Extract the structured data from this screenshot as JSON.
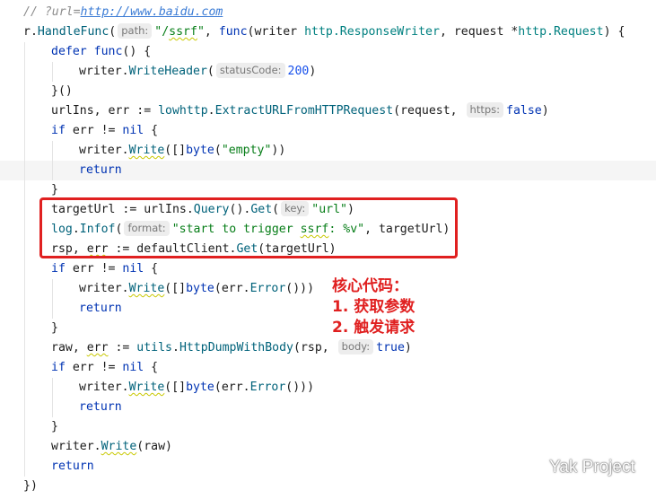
{
  "code": {
    "lines": [
      {
        "indent": 0,
        "tokens": [
          {
            "t": "// ?url=",
            "c": "cm"
          },
          {
            "t": "http://www.baidu.com",
            "c": "cm url"
          }
        ]
      },
      {
        "indent": 0,
        "tokens": [
          {
            "t": "r.",
            "c": ""
          },
          {
            "t": "HandleFunc",
            "c": "fn"
          },
          {
            "t": "(",
            "c": ""
          },
          {
            "hint": "path:"
          },
          {
            "t": "\"/",
            "c": "str"
          },
          {
            "t": "ssrf",
            "c": "str wavy"
          },
          {
            "t": "\"",
            "c": "str"
          },
          {
            "t": ", ",
            "c": ""
          },
          {
            "t": "func",
            "c": "kw"
          },
          {
            "t": "(writer ",
            "c": ""
          },
          {
            "t": "http.ResponseWriter",
            "c": "typ"
          },
          {
            "t": ", request *",
            "c": ""
          },
          {
            "t": "http.Request",
            "c": "typ"
          },
          {
            "t": ") {",
            "c": ""
          }
        ]
      },
      {
        "indent": 1,
        "tokens": [
          {
            "t": "defer ",
            "c": "kw"
          },
          {
            "t": "func",
            "c": "kw"
          },
          {
            "t": "() {",
            "c": ""
          }
        ]
      },
      {
        "indent": 2,
        "tokens": [
          {
            "t": "writer.",
            "c": ""
          },
          {
            "t": "WriteHeader",
            "c": "fn"
          },
          {
            "t": "(",
            "c": ""
          },
          {
            "hint": "statusCode:"
          },
          {
            "t": "200",
            "c": "num"
          },
          {
            "t": ")",
            "c": ""
          }
        ]
      },
      {
        "indent": 1,
        "tokens": [
          {
            "t": "}()",
            "c": ""
          }
        ]
      },
      {
        "indent": 1,
        "tokens": [
          {
            "t": "urlIns, err := ",
            "c": ""
          },
          {
            "t": "lowhttp",
            "c": "fn"
          },
          {
            "t": ".",
            "c": ""
          },
          {
            "t": "ExtractURLFromHTTPRequest",
            "c": "fn"
          },
          {
            "t": "(request, ",
            "c": ""
          },
          {
            "hint": "https:"
          },
          {
            "t": "false",
            "c": "kw"
          },
          {
            "t": ")",
            "c": ""
          }
        ]
      },
      {
        "indent": 1,
        "tokens": [
          {
            "t": "if ",
            "c": "kw"
          },
          {
            "t": "err != ",
            "c": ""
          },
          {
            "t": "nil",
            "c": "kw"
          },
          {
            "t": " {",
            "c": ""
          }
        ]
      },
      {
        "indent": 2,
        "tokens": [
          {
            "t": "writer.",
            "c": ""
          },
          {
            "t": "Write",
            "c": "fn wavy"
          },
          {
            "t": "([]",
            "c": ""
          },
          {
            "t": "byte",
            "c": "kw"
          },
          {
            "t": "(",
            "c": ""
          },
          {
            "t": "\"empty\"",
            "c": "str"
          },
          {
            "t": "))",
            "c": ""
          }
        ]
      },
      {
        "indent": 2,
        "hl": true,
        "tokens": [
          {
            "t": "return",
            "c": "kw"
          }
        ]
      },
      {
        "indent": 1,
        "tokens": [
          {
            "t": "}",
            "c": ""
          }
        ]
      },
      {
        "indent": 1,
        "tokens": [
          {
            "t": "targetUrl := urlIns.",
            "c": ""
          },
          {
            "t": "Query",
            "c": "fn"
          },
          {
            "t": "().",
            "c": ""
          },
          {
            "t": "Get",
            "c": "fn"
          },
          {
            "t": "(",
            "c": ""
          },
          {
            "hint": "key:"
          },
          {
            "t": "\"url\"",
            "c": "str"
          },
          {
            "t": ")",
            "c": ""
          }
        ]
      },
      {
        "indent": 1,
        "tokens": [
          {
            "t": "log",
            "c": "fn"
          },
          {
            "t": ".",
            "c": ""
          },
          {
            "t": "Infof",
            "c": "fn"
          },
          {
            "t": "(",
            "c": ""
          },
          {
            "hint": "format:"
          },
          {
            "t": "\"start to trigger ",
            "c": "str"
          },
          {
            "t": "ssrf",
            "c": "str wavy"
          },
          {
            "t": ": %v\"",
            "c": "str"
          },
          {
            "t": ", targetUrl)",
            "c": ""
          }
        ]
      },
      {
        "indent": 1,
        "tokens": [
          {
            "t": "rsp, ",
            "c": ""
          },
          {
            "t": "err",
            "c": "wavy"
          },
          {
            "t": " := defaultClient.",
            "c": ""
          },
          {
            "t": "Get",
            "c": "fn"
          },
          {
            "t": "(targetUrl)",
            "c": ""
          }
        ]
      },
      {
        "indent": 1,
        "tokens": [
          {
            "t": "if ",
            "c": "kw"
          },
          {
            "t": "err != ",
            "c": ""
          },
          {
            "t": "nil",
            "c": "kw"
          },
          {
            "t": " {",
            "c": ""
          }
        ]
      },
      {
        "indent": 2,
        "tokens": [
          {
            "t": "writer.",
            "c": ""
          },
          {
            "t": "Write",
            "c": "fn wavy"
          },
          {
            "t": "([]",
            "c": ""
          },
          {
            "t": "byte",
            "c": "kw"
          },
          {
            "t": "(err.",
            "c": ""
          },
          {
            "t": "Error",
            "c": "fn"
          },
          {
            "t": "()))",
            "c": ""
          }
        ]
      },
      {
        "indent": 2,
        "tokens": [
          {
            "t": "return",
            "c": "kw"
          }
        ]
      },
      {
        "indent": 1,
        "tokens": [
          {
            "t": "}",
            "c": ""
          }
        ]
      },
      {
        "indent": 1,
        "tokens": [
          {
            "t": "raw, ",
            "c": ""
          },
          {
            "t": "err",
            "c": "wavy"
          },
          {
            "t": " := ",
            "c": ""
          },
          {
            "t": "utils",
            "c": "fn"
          },
          {
            "t": ".",
            "c": ""
          },
          {
            "t": "HttpDumpWithBody",
            "c": "fn"
          },
          {
            "t": "(rsp, ",
            "c": ""
          },
          {
            "hint": "body:"
          },
          {
            "t": "true",
            "c": "kw"
          },
          {
            "t": ")",
            "c": ""
          }
        ]
      },
      {
        "indent": 1,
        "tokens": [
          {
            "t": "if ",
            "c": "kw"
          },
          {
            "t": "err != ",
            "c": ""
          },
          {
            "t": "nil",
            "c": "kw"
          },
          {
            "t": " {",
            "c": ""
          }
        ]
      },
      {
        "indent": 2,
        "tokens": [
          {
            "t": "writer.",
            "c": ""
          },
          {
            "t": "Write",
            "c": "fn wavy"
          },
          {
            "t": "([]",
            "c": ""
          },
          {
            "t": "byte",
            "c": "kw"
          },
          {
            "t": "(err.",
            "c": ""
          },
          {
            "t": "Error",
            "c": "fn"
          },
          {
            "t": "()))",
            "c": ""
          }
        ]
      },
      {
        "indent": 2,
        "tokens": [
          {
            "t": "return",
            "c": "kw"
          }
        ]
      },
      {
        "indent": 1,
        "tokens": [
          {
            "t": "}",
            "c": ""
          }
        ]
      },
      {
        "indent": 1,
        "tokens": [
          {
            "t": "writer.",
            "c": ""
          },
          {
            "t": "Write",
            "c": "fn wavy"
          },
          {
            "t": "(raw)",
            "c": ""
          }
        ]
      },
      {
        "indent": 1,
        "tokens": [
          {
            "t": "return",
            "c": "kw"
          }
        ]
      },
      {
        "indent": 0,
        "tokens": [
          {
            "t": "})",
            "c": ""
          }
        ]
      }
    ]
  },
  "annotation": {
    "line1": "核心代码：",
    "line2": "1. 获取参数",
    "line3": "2. 触发请求"
  },
  "watermark": {
    "icon": "wechat-icon",
    "text": "Yak Project"
  },
  "colors": {
    "keyword": "#0033b3",
    "function": "#00627a",
    "string": "#067d17",
    "number": "#1750eb",
    "annotation": "#e02020"
  }
}
